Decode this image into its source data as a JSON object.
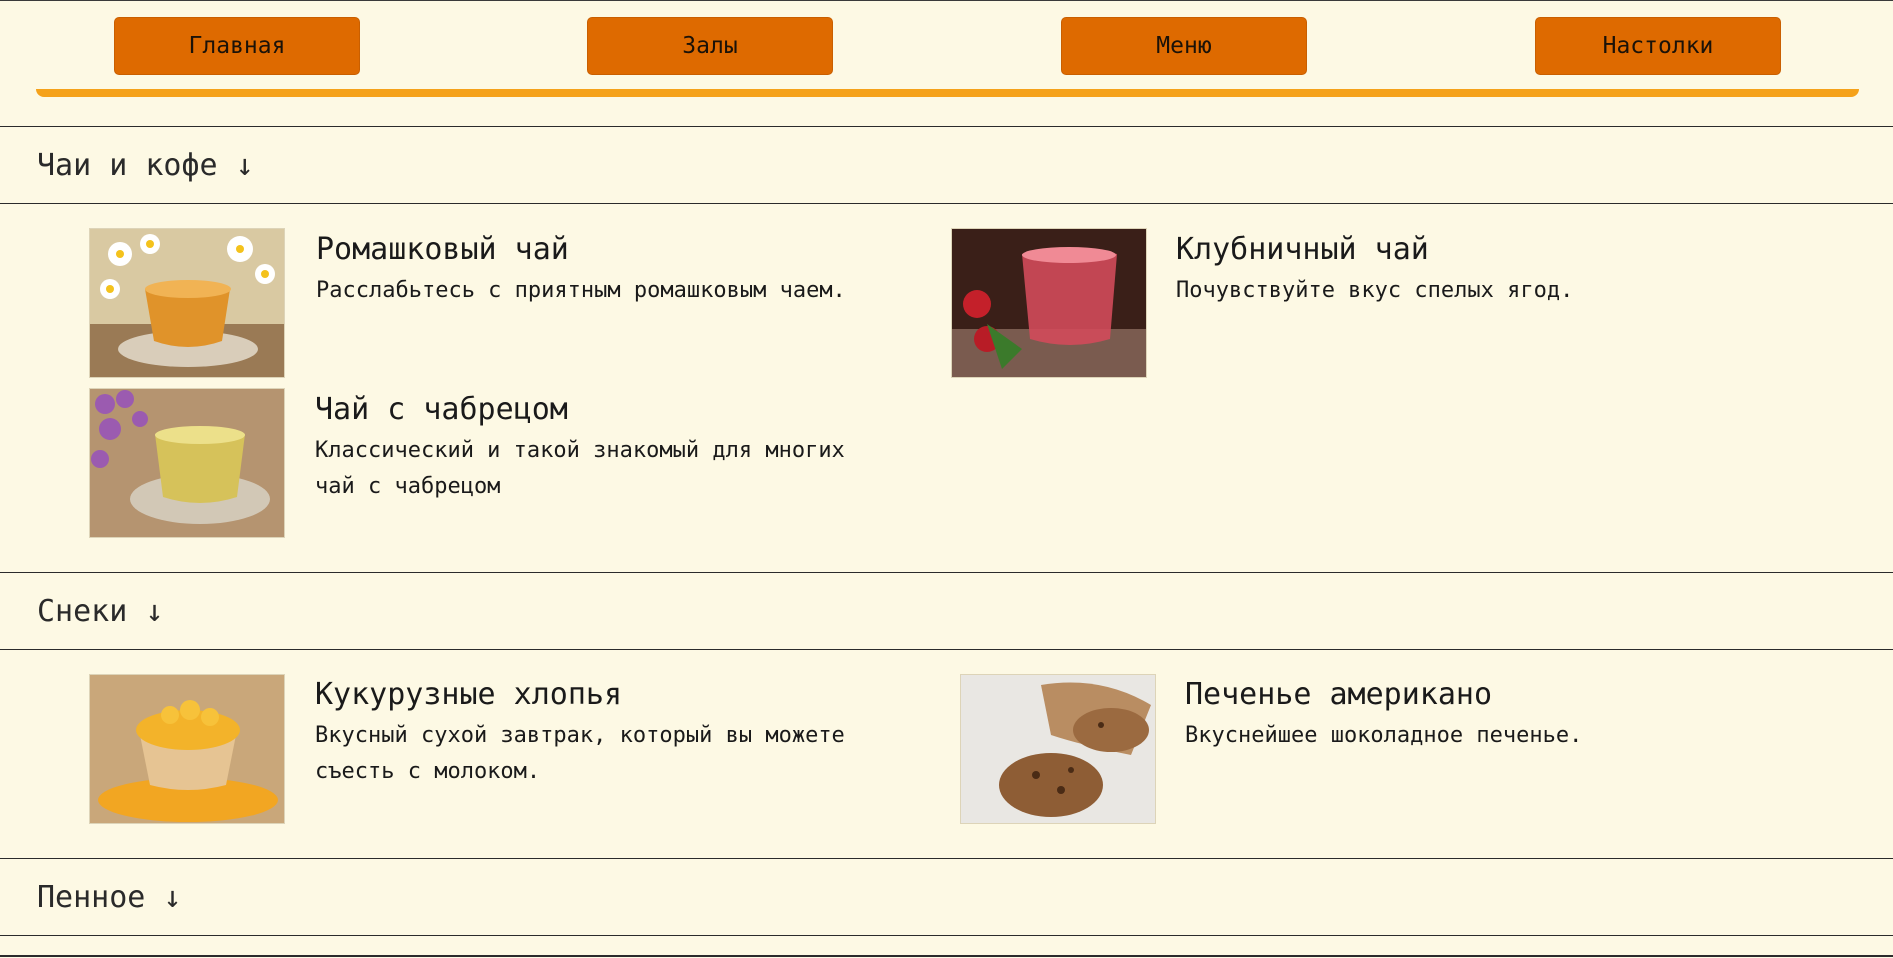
{
  "nav": {
    "items": [
      "Главная",
      "Залы",
      "Меню",
      "Настолки"
    ]
  },
  "sections": [
    {
      "title": "Чаи и кофе",
      "arrow": "↓",
      "items": [
        {
          "name": "Ромашковый чай",
          "desc": "Расслабьтесь с приятным ромашковым чаем.",
          "image": "chamomile-tea"
        },
        {
          "name": "Клубничный чай",
          "desc": "Почувствуйте вкус спелых ягод.",
          "image": "strawberry-tea"
        },
        {
          "name": "Чай с чабрецом",
          "desc": "Классический и такой знакомый для многих чай с чабрецом",
          "image": "thyme-tea"
        }
      ]
    },
    {
      "title": "Снеки",
      "arrow": "↓",
      "items": [
        {
          "name": "Кукурузные хлопья",
          "desc": "Вкусный сухой завтрак, который вы можете съесть с молоком.",
          "image": "corn-flakes"
        },
        {
          "name": "Печенье американо",
          "desc": "Вкуснейшее шоколадное печенье.",
          "image": "cookies"
        }
      ]
    },
    {
      "title": "Пенное",
      "arrow": "↓"
    }
  ],
  "colors": {
    "background": "#fdf9e4",
    "nav_button": "#de6a00",
    "accent": "#f5a21a"
  }
}
